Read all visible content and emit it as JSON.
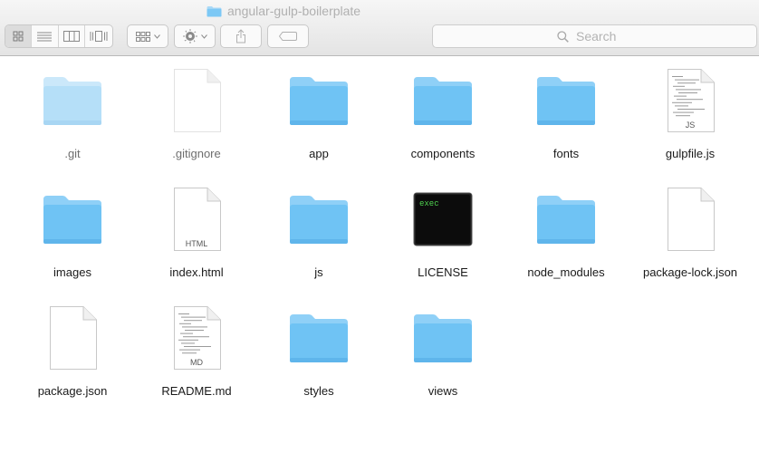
{
  "window": {
    "title": "angular-gulp-boilerplate"
  },
  "toolbar": {
    "view_modes": [
      "icon",
      "list",
      "column",
      "cover-flow"
    ],
    "active_view": "icon",
    "arrange_icon": "grid-arrange-icon",
    "action_icon": "gear-icon",
    "share_icon": "share-icon",
    "tag_icon": "tag-icon"
  },
  "search": {
    "placeholder": "Search"
  },
  "colors": {
    "folder": "#6fc3f4",
    "folder_tab": "#8fd0f7",
    "hidden_folder": "#b5dff8"
  },
  "files": [
    {
      "name": ".git",
      "kind": "folder",
      "hidden": true
    },
    {
      "name": ".gitignore",
      "kind": "document",
      "hidden": true,
      "badge": ""
    },
    {
      "name": "app",
      "kind": "folder",
      "hidden": false
    },
    {
      "name": "components",
      "kind": "folder",
      "hidden": false
    },
    {
      "name": "fonts",
      "kind": "folder",
      "hidden": false
    },
    {
      "name": "gulpfile.js",
      "kind": "code-document",
      "hidden": false,
      "badge": "JS"
    },
    {
      "name": "images",
      "kind": "folder",
      "hidden": false
    },
    {
      "name": "index.html",
      "kind": "document",
      "hidden": false,
      "badge": "HTML"
    },
    {
      "name": "js",
      "kind": "folder",
      "hidden": false
    },
    {
      "name": "LICENSE",
      "kind": "executable",
      "hidden": false,
      "badge": "exec"
    },
    {
      "name": "node_modules",
      "kind": "folder",
      "hidden": false
    },
    {
      "name": "package-lock.json",
      "kind": "document",
      "hidden": false,
      "badge": ""
    },
    {
      "name": "package.json",
      "kind": "document",
      "hidden": false,
      "badge": ""
    },
    {
      "name": "README.md",
      "kind": "code-document",
      "hidden": false,
      "badge": "MD"
    },
    {
      "name": "styles",
      "kind": "folder",
      "hidden": false
    },
    {
      "name": "views",
      "kind": "folder",
      "hidden": false
    }
  ]
}
